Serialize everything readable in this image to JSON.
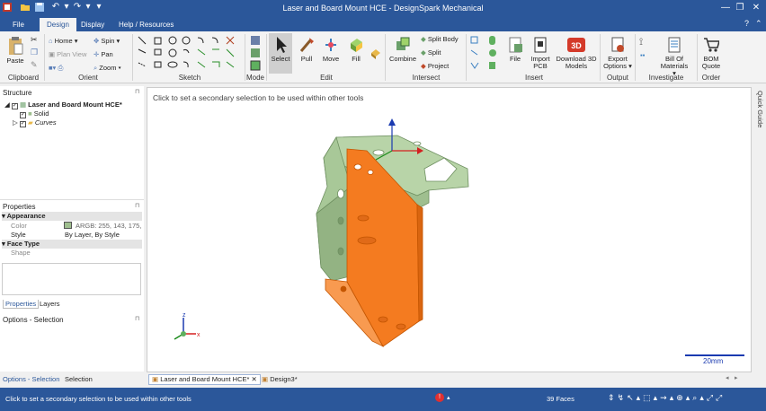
{
  "titlebar": {
    "title": "Laser and Board Mount HCE - DesignSpark Mechanical"
  },
  "tabs": [
    {
      "label": "File"
    },
    {
      "label": "Design"
    },
    {
      "label": "Display"
    },
    {
      "label": "Help / Resources"
    }
  ],
  "ribbon": {
    "clipboard": {
      "paste": "Paste",
      "label": "Clipboard"
    },
    "orient": {
      "home": "Home",
      "spin": "Spin",
      "plan_view": "Plan View",
      "pan": "Pan",
      "zoom": "Zoom",
      "label": "Orient"
    },
    "sketch": {
      "label": "Sketch"
    },
    "mode": {
      "label": "Mode"
    },
    "edit": {
      "select": "Select",
      "pull": "Pull",
      "move": "Move",
      "fill": "Fill",
      "label": "Edit"
    },
    "intersect": {
      "combine": "Combine",
      "split_body": "Split Body",
      "split": "Split",
      "project": "Project",
      "label": "Intersect"
    },
    "insert": {
      "file": "File",
      "import_pcb_1": "Import",
      "import_pcb_2": "PCB",
      "download_1": "Download 3D",
      "download_2": "Models",
      "label": "Insert"
    },
    "output": {
      "export_1": "Export",
      "export_2": "Options",
      "label": "Output"
    },
    "investigate": {
      "bom_1": "Bill Of",
      "bom_2": "Materials",
      "label": "Investigate"
    },
    "order": {
      "quote_1": "BOM",
      "quote_2": "Quote",
      "label": "Order"
    }
  },
  "structure": {
    "header": "Structure",
    "root": "Laser and Board Mount HCE*",
    "solid": "Solid",
    "curves": "Curves"
  },
  "properties": {
    "header": "Properties",
    "appearance": "Appearance",
    "color_label": "Color",
    "color_value": "ARGB: 255, 143, 175, ...",
    "style_label": "Style",
    "style_value": "By Layer, By Style",
    "face_type": "Face Type",
    "shape_label": "Shape",
    "tab_properties": "Properties",
    "tab_layers": "Layers"
  },
  "options": {
    "header": "Options - Selection",
    "tab_options": "Options - Selection",
    "tab_selection": "Selection"
  },
  "viewport": {
    "hint": "Click to set a secondary selection to be used within other tools",
    "scale": "20mm",
    "quick_guide": "Quick Guide"
  },
  "doc_tabs": [
    {
      "label": "Laser and Board Mount HCE*"
    },
    {
      "label": "Design3*"
    }
  ],
  "status": {
    "message": "Click to set a secondary selection to be used within other tools",
    "faces": "39 Faces"
  },
  "colors": {
    "accent": "#2b579a",
    "part_green": "#9fbf8f",
    "selection_orange": "#f47b20"
  }
}
